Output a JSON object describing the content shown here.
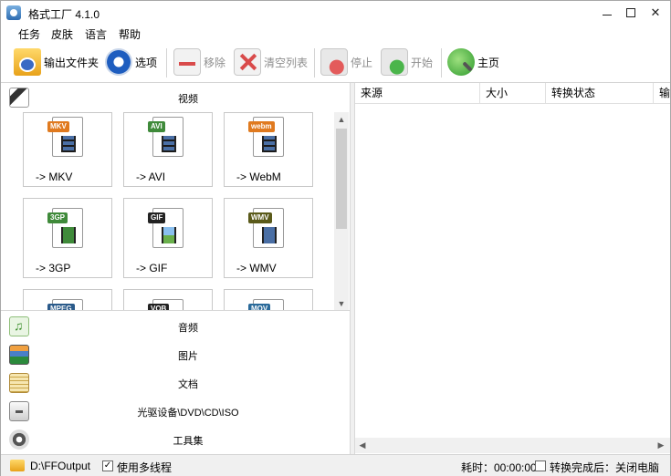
{
  "window": {
    "title": "格式工厂 4.1.0"
  },
  "menu": [
    "任务",
    "皮肤",
    "语言",
    "帮助"
  ],
  "toolbar": {
    "output_folder": "输出文件夹",
    "options": "选项",
    "remove": "移除",
    "clear_list": "清空列表",
    "stop": "停止",
    "start": "开始",
    "home": "主页"
  },
  "categories": {
    "video": "视频",
    "audio": "音频",
    "image": "图片",
    "document": "文档",
    "disc": "光驱设备\\DVD\\CD\\ISO",
    "tools": "工具集"
  },
  "formats": [
    {
      "label": "-> MKV",
      "badge": "MKV",
      "color": "#e07a1f"
    },
    {
      "label": "-> AVI",
      "badge": "AVI",
      "color": "#3f8a3a"
    },
    {
      "label": "-> WebM",
      "badge": "webm",
      "color": "#e07a1f"
    },
    {
      "label": "-> 3GP",
      "badge": "3GP",
      "color": "#3f8a3a"
    },
    {
      "label": "-> GIF",
      "badge": "GIF",
      "color": "#222222"
    },
    {
      "label": "-> WMV",
      "badge": "WMV",
      "color": "#5a5a1a"
    },
    {
      "label": "",
      "badge": "MPEG",
      "color": "#2a5a8a"
    },
    {
      "label": "",
      "badge": "VOB",
      "color": "#222222"
    },
    {
      "label": "",
      "badge": "MOV",
      "color": "#2a6a9a"
    }
  ],
  "task_list": {
    "columns": [
      "来源",
      "大小",
      "转换状态",
      "输"
    ]
  },
  "status": {
    "output_path": "D:\\FFOutput",
    "multithread_label": "使用多线程",
    "multithread_checked": true,
    "elapsed": "耗时：00:00:00",
    "after_convert": "转换完成后：关闭电脑",
    "after_convert_checked": false
  }
}
